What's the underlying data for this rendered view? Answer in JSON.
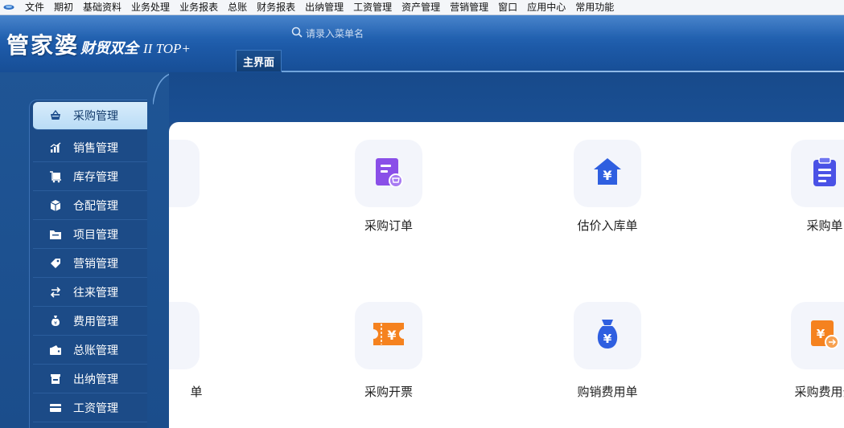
{
  "menubar": {
    "items": [
      "文件",
      "期初",
      "基础资料",
      "业务处理",
      "业务报表",
      "总账",
      "财务报表",
      "出纳管理",
      "工资管理",
      "资产管理",
      "营销管理",
      "窗口",
      "应用中心",
      "常用功能"
    ]
  },
  "header": {
    "logo_main": "管家婆",
    "logo_sub": "财贸双全",
    "logo_version": "II TOP+",
    "search_placeholder": "请录入菜单名",
    "tab_label": "主界面"
  },
  "sidebar": {
    "items": [
      {
        "label": "采购管理",
        "icon": "basket-icon",
        "active": true
      },
      {
        "label": "销售管理",
        "icon": "sales-chart-icon",
        "active": false
      },
      {
        "label": "库存管理",
        "icon": "inventory-cart-icon",
        "active": false
      },
      {
        "label": "仓配管理",
        "icon": "package-box-icon",
        "active": false
      },
      {
        "label": "项目管理",
        "icon": "folder-icon",
        "active": false
      },
      {
        "label": "营销管理",
        "icon": "tag-icon",
        "active": false
      },
      {
        "label": "往来管理",
        "icon": "exchange-arrows-icon",
        "active": false
      },
      {
        "label": "费用管理",
        "icon": "money-bag-icon",
        "active": false
      },
      {
        "label": "总账管理",
        "icon": "wallet-icon",
        "active": false
      },
      {
        "label": "出纳管理",
        "icon": "cash-register-icon",
        "active": false
      },
      {
        "label": "工资管理",
        "icon": "card-icon",
        "active": false
      }
    ]
  },
  "main": {
    "row1": [
      {
        "label": "采购订单",
        "icon": "purchase-order-icon"
      },
      {
        "label": "估价入库单",
        "icon": "warehouse-yuan-icon"
      },
      {
        "label": "采购单",
        "icon": "clipboard-icon"
      }
    ],
    "row2": [
      {
        "label": "单",
        "icon": ""
      },
      {
        "label": "采购开票",
        "icon": "invoice-ticket-icon"
      },
      {
        "label": "购销费用单",
        "icon": "money-bag-yuan-icon"
      },
      {
        "label": "采购费用分",
        "icon": "cost-allocation-icon"
      }
    ]
  },
  "colors": {
    "header_blue": "#1d5aa8",
    "sidebar_blue": "#1c4b87",
    "active_item_bg": "#c6e3f8",
    "purple_icon": "#8a4fe8",
    "blue_icon": "#2f5fe0",
    "orange_icon": "#f5821f"
  }
}
